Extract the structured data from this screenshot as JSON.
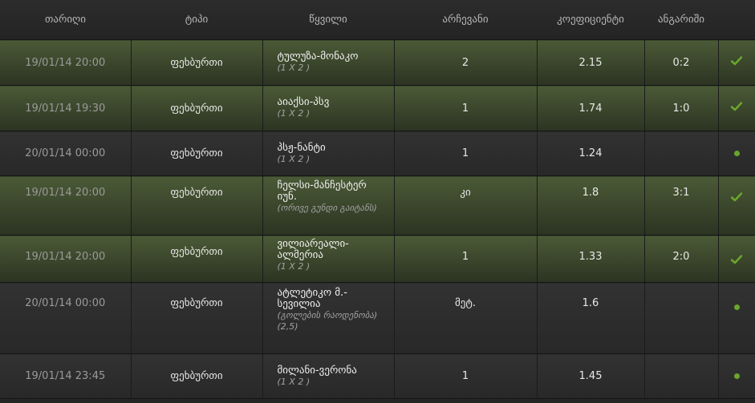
{
  "headers": {
    "date": "თარიღი",
    "type": "ტიპი",
    "match": "წყვილი",
    "pick": "არჩევანი",
    "odds": "კოეფიციენტი",
    "score": "ანგარიში"
  },
  "colors": {
    "won_row": "#4a5a36",
    "pending_row": "#323232",
    "status_green": "#6aa52c"
  },
  "rows": [
    {
      "date": "19/01/14 20:00",
      "type": "ფეხბურთი",
      "match": "ტულუზა-მონაკო",
      "market": "(1 X 2 )",
      "pick": "2",
      "odds": "2.15",
      "score": "0:2",
      "status": "won",
      "status_icon": "check-icon"
    },
    {
      "date": "19/01/14 19:30",
      "type": "ფეხბურთი",
      "match": "აიაქსი-პსვ",
      "market": "(1 X 2 )",
      "pick": "1",
      "odds": "1.74",
      "score": "1:0",
      "status": "won",
      "status_icon": "check-icon"
    },
    {
      "date": "20/01/14 00:00",
      "type": "ფეხბურთი",
      "match": "პსჟ-ნანტი",
      "market": "(1 X 2 )",
      "pick": "1",
      "odds": "1.24",
      "score": "",
      "status": "pending",
      "status_icon": "dot-icon"
    },
    {
      "date": "19/01/14 20:00",
      "type": "ფეხბურთი",
      "match": "ჩელსი-მანჩესტერ იუნ.",
      "market": "(ორივე გუნდი გაიტანს)",
      "pick": "კი",
      "odds": "1.8",
      "score": "3:1",
      "status": "won",
      "status_icon": "check-icon"
    },
    {
      "date": "19/01/14 20:00",
      "type": "ფეხბურთი",
      "match": "ვილიარეალი-ალმერია",
      "market": "(1 X 2 )",
      "pick": "1",
      "odds": "1.33",
      "score": "2:0",
      "status": "won",
      "status_icon": "check-icon"
    },
    {
      "date": "20/01/14 00:00",
      "type": "ფეხბურთი",
      "match": "ატლეტიკო მ.-სევილია",
      "market": "(გოლების რაოდენობა) (2,5)",
      "pick": "მეტ.",
      "odds": "1.6",
      "score": "",
      "status": "pending",
      "status_icon": "dot-icon"
    },
    {
      "date": "19/01/14 23:45",
      "type": "ფეხბურთი",
      "match": "მილანი-ვერონა",
      "market": "(1 X 2 )",
      "pick": "1",
      "odds": "1.45",
      "score": "",
      "status": "pending",
      "status_icon": "dot-icon"
    }
  ]
}
